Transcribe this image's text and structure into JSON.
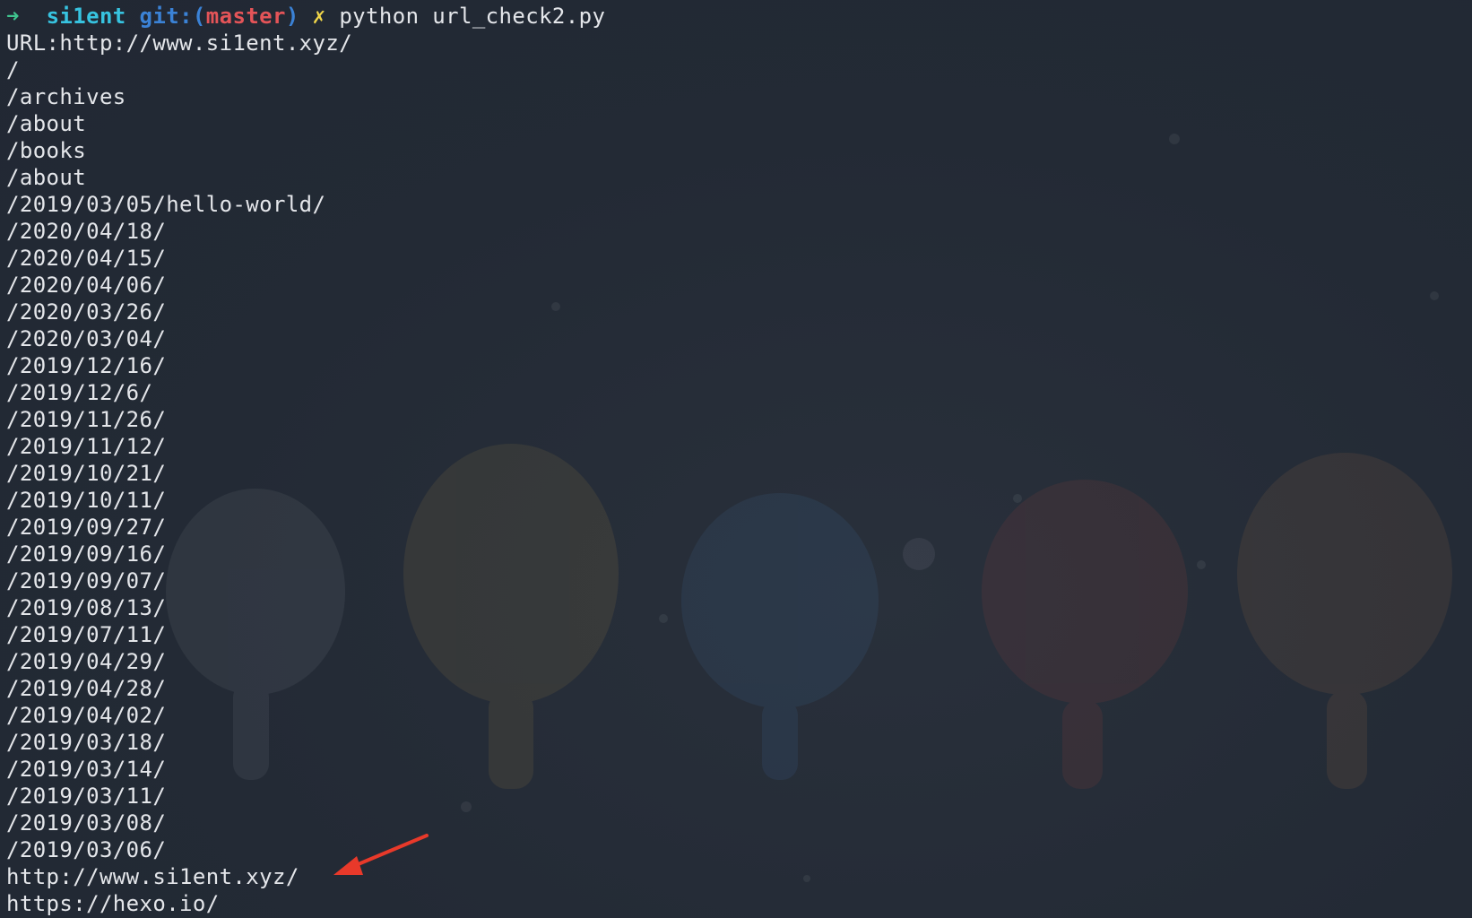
{
  "prompt": {
    "arrow": "➜",
    "user": "si1ent",
    "git_label": "git:(",
    "branch": "master",
    "git_close": ")",
    "dirty_mark": "✗",
    "command": "python url_check2.py"
  },
  "output_lines": [
    "URL:http://www.si1ent.xyz/",
    "/",
    "/archives",
    "/about",
    "/books",
    "/about",
    "/2019/03/05/hello-world/",
    "/2020/04/18/",
    "/2020/04/15/",
    "/2020/04/06/",
    "/2020/03/26/",
    "/2020/03/04/",
    "/2019/12/16/",
    "/2019/12/6/",
    "/2019/11/26/",
    "/2019/11/12/",
    "/2019/10/21/",
    "/2019/10/11/",
    "/2019/09/27/",
    "/2019/09/16/",
    "/2019/09/07/",
    "/2019/08/13/",
    "/2019/07/11/",
    "/2019/04/29/",
    "/2019/04/28/",
    "/2019/04/02/",
    "/2019/03/18/",
    "/2019/03/14/",
    "/2019/03/11/",
    "/2019/03/08/",
    "/2019/03/06/",
    "http://www.si1ent.xyz/",
    "https://hexo.io/"
  ],
  "colors": {
    "background": "#232a35",
    "text": "#e4e6ea",
    "arrow": "#3fc58f",
    "user": "#37c3e0",
    "git": "#3b82d6",
    "branch": "#e45458",
    "dirty": "#f1d64a",
    "annotation_arrow": "#e8392a"
  },
  "icons": {
    "annotation": "red-arrow-pointer"
  }
}
